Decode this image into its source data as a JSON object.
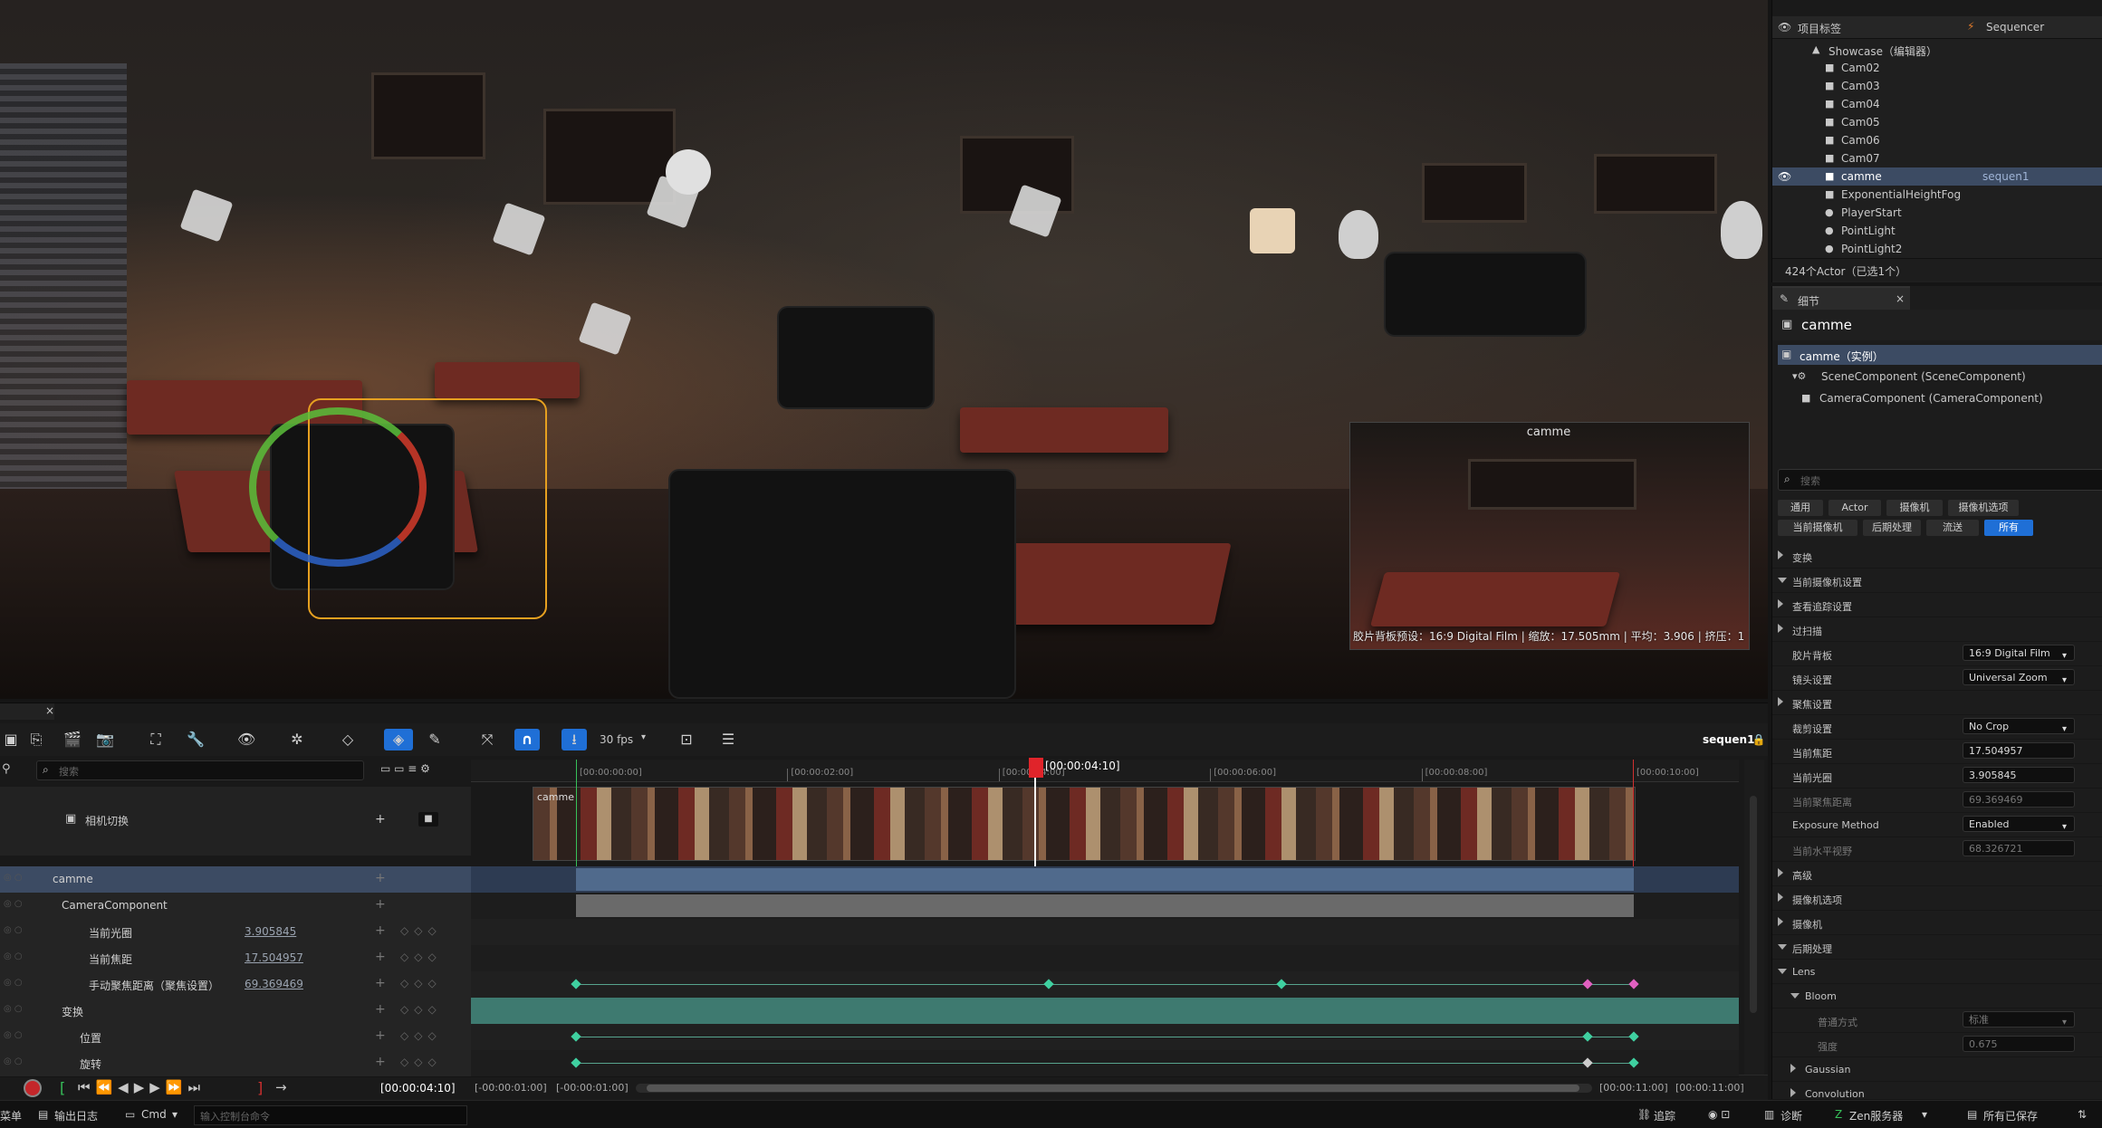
{
  "viewport": {
    "pip_title": "camme",
    "pip_info": "胶片背板预设：16:9 Digital Film | 缩放：17.505mm | 平均：3.906 | 挤压：1"
  },
  "outliner": {
    "col_label": "项目标签",
    "col_type": "Sequencer",
    "items": [
      {
        "label": "Showcase（编辑器）",
        "type": ""
      },
      {
        "label": "Cam02",
        "type": ""
      },
      {
        "label": "Cam03",
        "type": ""
      },
      {
        "label": "Cam04",
        "type": ""
      },
      {
        "label": "Cam05",
        "type": ""
      },
      {
        "label": "Cam06",
        "type": ""
      },
      {
        "label": "Cam07",
        "type": ""
      },
      {
        "label": "camme",
        "type": "sequen1"
      },
      {
        "label": "ExponentialHeightFog",
        "type": ""
      },
      {
        "label": "PlayerStart",
        "type": ""
      },
      {
        "label": "PointLight",
        "type": ""
      },
      {
        "label": "PointLight2",
        "type": ""
      }
    ],
    "footer": "424个Actor（已选1个）"
  },
  "details": {
    "tab_label": "细节",
    "close": "×",
    "object_name": "camme",
    "instance_label": "camme（实例）",
    "components": [
      "SceneComponent (SceneComponent)",
      "CameraComponent (CameraComponent)"
    ],
    "search_placeholder": "搜索",
    "filters": [
      "通用",
      "Actor",
      "摄像机",
      "摄像机选项",
      "当前摄像机",
      "后期处理",
      "流送",
      "所有"
    ],
    "sections": [
      {
        "label": "变换",
        "value": ""
      },
      {
        "label": "当前摄像机设置",
        "value": ""
      },
      {
        "label": "查看追踪设置",
        "value": ""
      },
      {
        "label": "过扫描",
        "value": ""
      },
      {
        "label": "胶片背板",
        "value": "16:9 Digital Film"
      },
      {
        "label": "镜头设置",
        "value": "Universal Zoom"
      },
      {
        "label": "聚焦设置",
        "value": ""
      },
      {
        "label": "裁剪设置",
        "value": "No Crop"
      },
      {
        "label": "当前焦距",
        "value": "17.504957"
      },
      {
        "label": "当前光圈",
        "value": "3.905845"
      },
      {
        "label": "当前聚焦距离",
        "value": "69.369469"
      },
      {
        "label": "Exposure Method",
        "value": "Enabled"
      },
      {
        "label": "当前水平视野",
        "value": "68.326721"
      },
      {
        "label": "高级",
        "value": ""
      },
      {
        "label": "摄像机选项",
        "value": ""
      },
      {
        "label": "摄像机",
        "value": ""
      },
      {
        "label": "后期处理",
        "value": ""
      },
      {
        "label": "Lens",
        "value": ""
      },
      {
        "label": "Bloom",
        "value": ""
      },
      {
        "label": "普通方式",
        "value": "标准"
      },
      {
        "label": "强度",
        "value": "0.675"
      },
      {
        "label": "Gaussian",
        "value": ""
      },
      {
        "label": "Convolution",
        "value": ""
      }
    ]
  },
  "sequencer": {
    "fps": "30 fps",
    "sequence_name": "sequen1",
    "search_placeholder": "搜索",
    "current_time": "[00:00:04:10]",
    "ruler": [
      "[00:00:00:00]",
      "[00:00:02:00]",
      "[00:00:04:00]",
      "[00:00:06:00]",
      "[00:00:08:00]",
      "[00:00:10:00]"
    ],
    "shot_label": "camme",
    "tracks": [
      {
        "name": "相机切换",
        "value": ""
      },
      {
        "name": "camme",
        "value": ""
      },
      {
        "name": "CameraComponent",
        "value": ""
      },
      {
        "name": "当前光圈",
        "value": "3.905845"
      },
      {
        "name": "当前焦距",
        "value": "17.504957"
      },
      {
        "name": "手动聚焦距离（聚焦设置）",
        "value": "69.369469"
      },
      {
        "name": "变换",
        "value": ""
      },
      {
        "name": "位置",
        "value": ""
      },
      {
        "name": "旋转",
        "value": ""
      }
    ],
    "playback_time": "[00:00:04:10]",
    "range_start_a": "[-00:00:01:00]",
    "range_start_b": "[-00:00:01:00]",
    "range_end_a": "[00:00:11:00]",
    "range_end_b": "[00:00:11:00]"
  },
  "statusbar": {
    "menu": "菜单",
    "output_log": "输出日志",
    "cmd": "Cmd",
    "console_placeholder": "输入控制台命令",
    "trace": "追踪",
    "diagnostics": "诊断",
    "zen": "Zen服务器",
    "saved": "所有已保存"
  },
  "colors": {
    "accent": "#1f6fd6",
    "selection": "#3c4b63",
    "playhead": "#e0242a",
    "track_teal": "#3e7a70"
  }
}
